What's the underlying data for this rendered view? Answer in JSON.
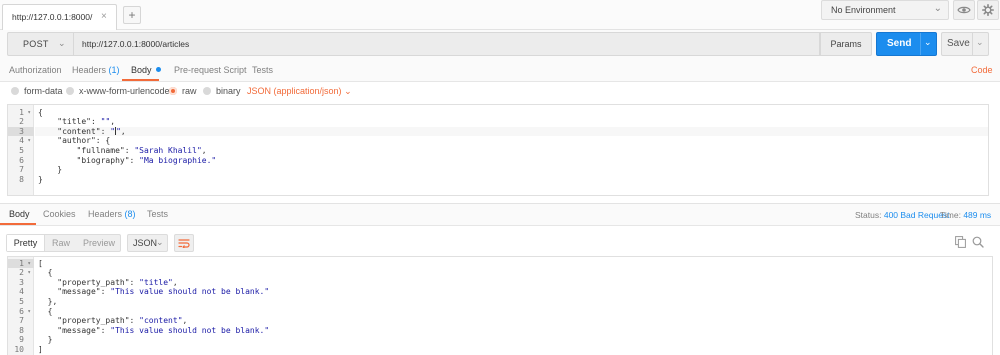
{
  "top_bar": {
    "tab_label": "http://127.0.0.1:8000/",
    "tab_close": "×",
    "add_tab": "+",
    "environment": "No Environment",
    "environment_chevron": "⌄",
    "eye_icon": "eye-icon",
    "gear_icon": "gear-icon"
  },
  "request": {
    "method": "POST",
    "method_chevron": "⌄",
    "url": "http://127.0.0.1:8000/articles",
    "params_label": "Params",
    "send_label": "Send",
    "send_chevron": "⌄",
    "save_label": "Save",
    "save_chevron": "⌄"
  },
  "request_tabs": [
    {
      "label": "Authorization"
    },
    {
      "label": "Headers",
      "count": "(1)"
    },
    {
      "label": "Body"
    },
    {
      "label": "Pre-request Script"
    },
    {
      "label": "Tests"
    }
  ],
  "code_link": "Code",
  "body_types": {
    "options": [
      "form-data",
      "x-www-form-urlencoded",
      "raw",
      "binary"
    ],
    "selected": "raw",
    "content_type": "JSON (application/json)",
    "content_type_chevron": "⌄"
  },
  "request_body": {
    "line_numbers": [
      "1",
      "2",
      "3",
      "4",
      "5",
      "6",
      "7",
      "8"
    ],
    "lines": {
      "l1": "{",
      "l2_key": "    \"title\": ",
      "l2_val": "\"\"",
      "l2_end": ",",
      "l3_key": "    \"content\": ",
      "l3_val_a": "\"",
      "l3_val_b": "\"",
      "l3_end": ",",
      "l4_key": "    \"author\": {",
      "l5_key": "        \"fullname\": ",
      "l5_val": "\"Sarah Khalil\"",
      "l5_end": ",",
      "l6_key": "        \"biography\": ",
      "l6_val": "\"Ma biographie.\"",
      "l7": "    }",
      "l8": "}"
    }
  },
  "response_tabs": [
    {
      "label": "Body"
    },
    {
      "label": "Cookies"
    },
    {
      "label": "Headers",
      "count": "(8)"
    },
    {
      "label": "Tests"
    }
  ],
  "response_status": {
    "status_label": "Status:",
    "status_value": "400 Bad Request",
    "time_label": "Time:",
    "time_value": "489 ms"
  },
  "response_view": {
    "modes": [
      "Pretty",
      "Raw",
      "Preview"
    ],
    "active_mode": "Pretty",
    "format": "JSON",
    "format_chevron": "⌄"
  },
  "response_body": {
    "line_numbers": [
      "1",
      "2",
      "3",
      "4",
      "5",
      "6",
      "7",
      "8",
      "9",
      "10"
    ],
    "lines": {
      "l1": "[",
      "l2": "  {",
      "l3_key": "    \"property_path\": ",
      "l3_val": "\"title\"",
      "l3_end": ",",
      "l4_key": "    \"message\": ",
      "l4_val": "\"This value should not be blank.\"",
      "l5": "  },",
      "l6": "  {",
      "l7_key": "    \"property_path\": ",
      "l7_val": "\"content\"",
      "l7_end": ",",
      "l8_key": "    \"message\": ",
      "l8_val": "\"This value should not be blank.\"",
      "l9": "  }",
      "l10": "]"
    }
  },
  "colors": {
    "accent": "#f26b3a",
    "primary": "#1c8dee",
    "string": "#1a1aa6"
  }
}
